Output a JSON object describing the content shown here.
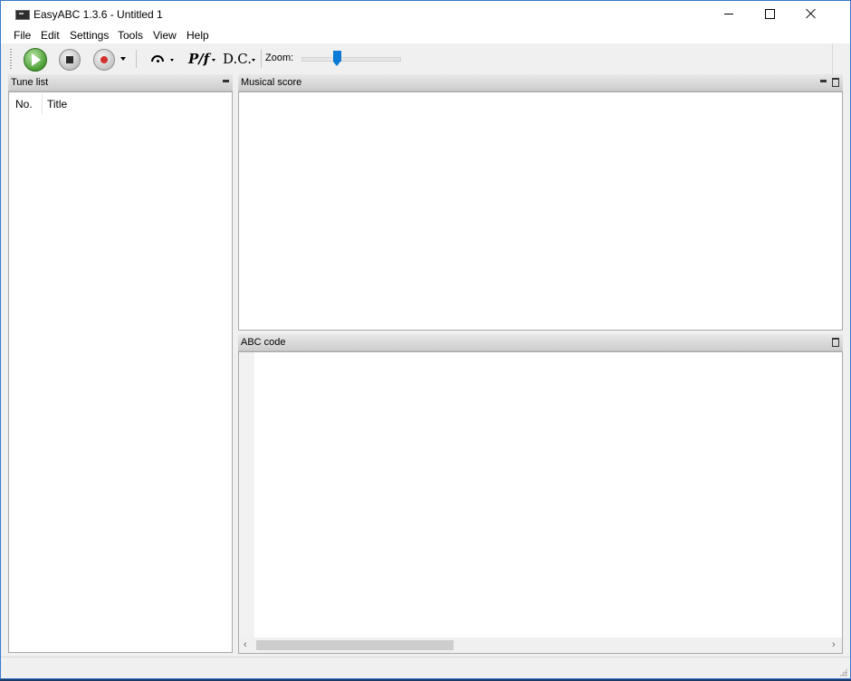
{
  "window": {
    "title": "EasyABC 1.3.6 - Untitled 1"
  },
  "menu": [
    "File",
    "Edit",
    "Settings",
    "Tools",
    "View",
    "Help"
  ],
  "toolbar": {
    "dynamics_label": "P/f",
    "dc_label": "D.C.",
    "zoom_label": "Zoom:",
    "zoom_level": 0.35
  },
  "tune_list": {
    "title": "Tune list",
    "columns": [
      "No.",
      "Title"
    ]
  },
  "musical_score": {
    "title": "Musical score"
  },
  "abc_code": {
    "title": "ABC code"
  },
  "icons": {
    "app": "app-icon",
    "play": "play-icon",
    "stop": "stop-icon",
    "record": "record-icon",
    "fermata": "fermata-icon"
  },
  "colors": {
    "accent": "#0a7ad6",
    "play_green": "#4a9c32",
    "record_red": "#d0312d",
    "window_border": "#3a78c9"
  }
}
